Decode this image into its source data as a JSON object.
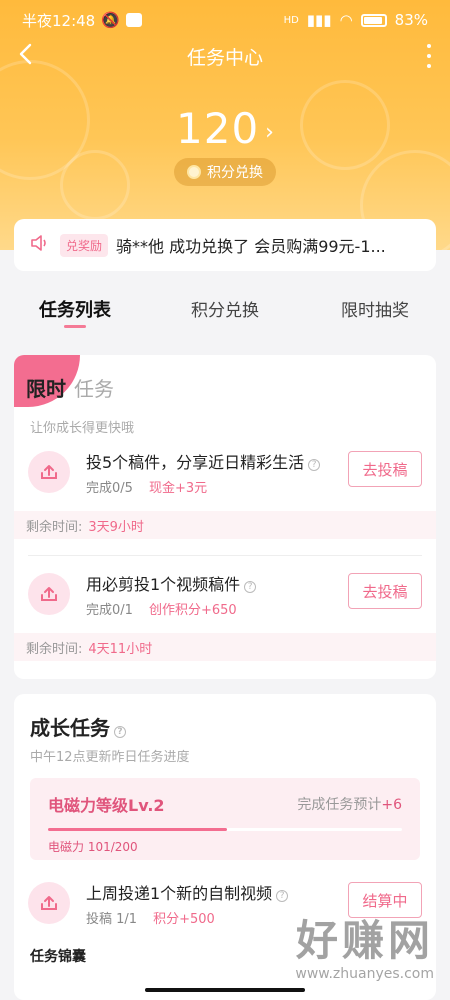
{
  "status_bar": {
    "time": "半夜12:48",
    "battery": "83%"
  },
  "header": {
    "title": "任务中心"
  },
  "points": {
    "value": "120",
    "exchange_label": "积分兑换"
  },
  "notice": {
    "badge": "兑奖励",
    "message": "骑**他 成功兑换了 会员购满99元-1..."
  },
  "tabs": [
    {
      "label": "任务列表",
      "active": true
    },
    {
      "label": "积分兑换",
      "active": false
    },
    {
      "label": "限时抽奖",
      "active": false
    }
  ],
  "limited_card": {
    "badge_text": "限时",
    "title": "任务",
    "subtitle": "让你成长得更快哦",
    "tasks": [
      {
        "title": "投5个稿件，分享近日精彩生活",
        "progress": "完成0/5",
        "reward": "现金+3元",
        "button": "去投稿",
        "remain_label": "剩余时间:",
        "remain_value": "3天9小时"
      },
      {
        "title": "用必剪投1个视频稿件",
        "progress": "完成0/1",
        "reward": "创作积分+650",
        "button": "去投稿",
        "remain_label": "剩余时间:",
        "remain_value": "4天11小时"
      }
    ]
  },
  "growth_card": {
    "title": "成长任务",
    "subtitle": "中午12点更新昨日任务进度",
    "level": {
      "name": "电磁力等级Lv.2",
      "hint": "完成任务预计",
      "hint_plus": "+6",
      "value_text": "电磁力 101/200",
      "progress": 0.505
    },
    "task": {
      "title": "上周投递1个新的自制视频",
      "progress": "投稿 1/1",
      "reward": "积分+500",
      "button": "结算中"
    },
    "pouch_title": "任务锦囊"
  },
  "watermark": {
    "big": "好赚网",
    "small": "www.zhuanyes.com"
  },
  "colors": {
    "accent": "#f36d90",
    "hero": "#ffba3c"
  }
}
